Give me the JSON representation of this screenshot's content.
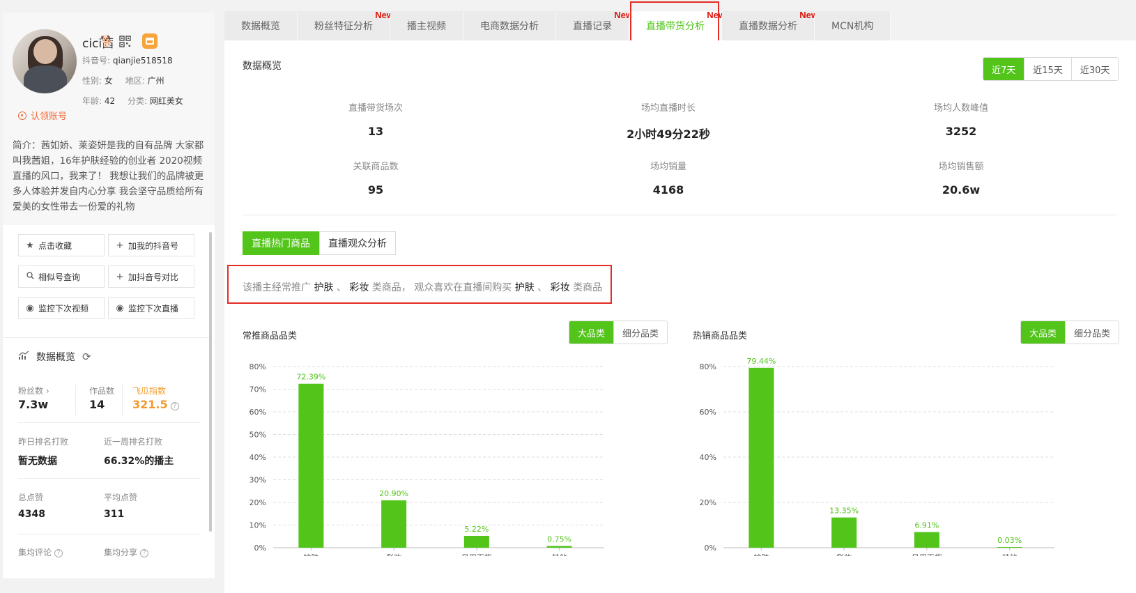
{
  "profile": {
    "nickname": "cici茜",
    "douyin_id_label": "抖音号:",
    "douyin_id": "qianjie518518",
    "gender_label": "性别:",
    "gender": "女",
    "region_label": "地区:",
    "region": "广州",
    "age_label": "年龄:",
    "age": "42",
    "category_label": "分类:",
    "category": "网红美女",
    "claim_text": "认领账号",
    "bio": "简介：茜如娇、莱姿妍是我的自有品牌 大家都叫我茜姐，16年护肤经验的创业者 2020视频直播的风口，我来了！ 我想让我们的品牌被更多人体验并发自内心分享 我会坚守品质给所有爱美的女性带去一份爱的礼物"
  },
  "actions": {
    "favorite": "点击收藏",
    "add_mine": "加我的抖音号",
    "similar": "相似号查询",
    "compare": "加抖音号对比",
    "monitor_video": "监控下次视频",
    "monitor_live": "监控下次直播"
  },
  "overview": {
    "title": "数据概览",
    "fans_label": "粉丝数",
    "fans": "7.3w",
    "works_label": "作品数",
    "works": "14",
    "index_label": "飞瓜指数",
    "index": "321.5",
    "rank_yesterday_label": "昨日排名打败",
    "rank_yesterday": "暂无数据",
    "rank_week_label": "近一周排名打败",
    "rank_week": "66.32%的播主",
    "total_likes_label": "总点赞",
    "total_likes": "4348",
    "avg_likes_label": "平均点赞",
    "avg_likes": "311",
    "avg_comments_label": "集均评论",
    "avg_shares_label": "集均分享"
  },
  "tabs": [
    {
      "label": "数据概览",
      "new": false
    },
    {
      "label": "粉丝特征分析",
      "new": true
    },
    {
      "label": "播主视频",
      "new": false
    },
    {
      "label": "电商数据分析",
      "new": false
    },
    {
      "label": "直播记录",
      "new": true
    },
    {
      "label": "直播带货分析",
      "new": true
    },
    {
      "label": "直播数据分析",
      "new": true
    },
    {
      "label": "MCN机构",
      "new": false
    }
  ],
  "new_tag": "New",
  "panel": {
    "title": "数据概览",
    "ranges": [
      "近7天",
      "近15天",
      "近30天"
    ],
    "kpis": [
      {
        "label": "直播带货场次",
        "value": "13"
      },
      {
        "label": "场均直播时长",
        "value": "2小时49分22秒"
      },
      {
        "label": "场均人数峰值",
        "value": "3252"
      },
      {
        "label": "关联商品数",
        "value": "95"
      },
      {
        "label": "场均销量",
        "value": "4168"
      },
      {
        "label": "场均销售额",
        "value": "20.6w"
      }
    ],
    "subtabs": [
      "直播热门商品",
      "直播观众分析"
    ],
    "summary": {
      "p1": "该播主经常推广",
      "c1": "护肤",
      "sep1": "、",
      "c2": "彩妆",
      "p2": "类商品，",
      "p3": "观众喜欢在直播间购买",
      "c3": "护肤",
      "sep2": "、",
      "c4": "彩妆",
      "p4": "类商品"
    },
    "chart_toggle": [
      "大品类",
      "细分品类"
    ]
  },
  "chart_data": [
    {
      "type": "bar",
      "title": "常推商品品类",
      "categories": [
        "护肤",
        "彩妆",
        "日用百货",
        "其他"
      ],
      "values": [
        72.39,
        20.9,
        5.22,
        0.75
      ],
      "labels": [
        "72.39%",
        "20.90%",
        "5.22%",
        "0.75%"
      ],
      "ylim": [
        0,
        80
      ],
      "yticks": [
        0,
        10,
        20,
        30,
        40,
        50,
        60,
        70,
        80
      ],
      "ytick_labels": [
        "0%",
        "10%",
        "20%",
        "30%",
        "40%",
        "50%",
        "60%",
        "70%",
        "80%"
      ],
      "grid": true,
      "color": "#52c41a"
    },
    {
      "type": "bar",
      "title": "热销商品品类",
      "categories": [
        "护肤",
        "彩妆",
        "日用百货",
        "其他"
      ],
      "values": [
        79.44,
        13.35,
        6.91,
        0.03
      ],
      "labels": [
        "79.44%",
        "13.35%",
        "6.91%",
        "0.03%"
      ],
      "ylim": [
        0,
        80
      ],
      "yticks": [
        0,
        20,
        40,
        60,
        80
      ],
      "ytick_labels": [
        "0%",
        "20%",
        "40%",
        "60%",
        "80%"
      ],
      "grid": true,
      "color": "#52c41a"
    }
  ]
}
